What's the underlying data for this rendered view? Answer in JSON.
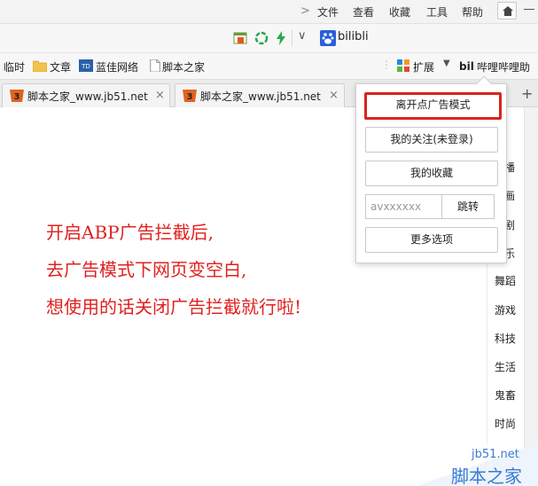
{
  "menubar": {
    "items": [
      "文件",
      "查看",
      "收藏",
      "工具",
      "帮助"
    ]
  },
  "addressbar": {
    "search_text": "bilibli"
  },
  "bookmarks": {
    "items": [
      "临时",
      "文章",
      "蓝佳网络",
      "脚本之家"
    ],
    "extensions_label": "扩展",
    "bilibili_label": "哔哩哔哩助"
  },
  "tabs": [
    {
      "label": "脚本之家_www.jb51.net",
      "close": "×"
    },
    {
      "label": "脚本之家_www.jb51.net",
      "close": "×"
    }
  ],
  "newtab_label": "+",
  "popup": {
    "leave_ad_mode": "离开点广告模式",
    "my_follows": "我的关注(未登录)",
    "my_favorites": "我的收藏",
    "av_placeholder": "avxxxxxx",
    "jump": "跳转",
    "more_options": "更多选项"
  },
  "content": {
    "lines": [
      "开启ABP广告拦截后,",
      "去广告模式下网页变空白,",
      "想使用的话关闭广告拦截就行啦!"
    ]
  },
  "categories": [
    "播",
    "画",
    "剧",
    "乐",
    "舞蹈",
    "游戏",
    "科技",
    "生活",
    "鬼畜",
    "时尚"
  ],
  "watermark": {
    "url": "jb51.net",
    "name": "脚本之家"
  },
  "colors": {
    "highlight_red": "#d9241c",
    "content_red": "#e02020",
    "watermark_blue": "#3a7bd5"
  }
}
